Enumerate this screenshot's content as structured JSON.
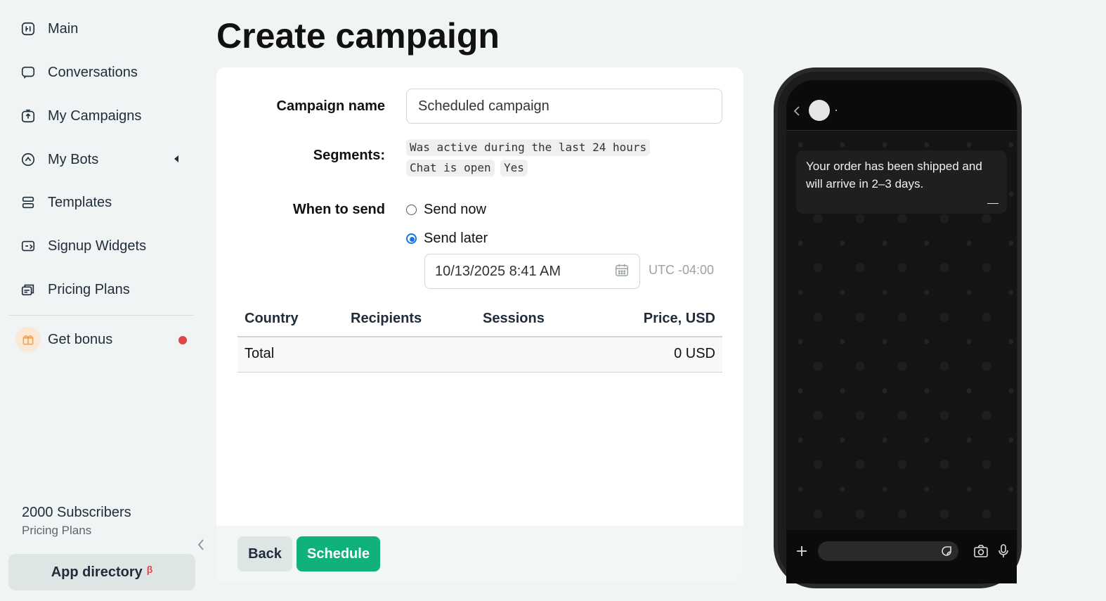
{
  "sidebar": {
    "items": [
      {
        "label": "Main",
        "icon": "home-icon"
      },
      {
        "label": "Conversations",
        "icon": "chat-icon"
      },
      {
        "label": "My Campaigns",
        "icon": "campaign-icon"
      },
      {
        "label": "My Bots",
        "icon": "bot-icon"
      },
      {
        "label": "Templates",
        "icon": "templates-icon"
      },
      {
        "label": "Signup Widgets",
        "icon": "widget-icon"
      },
      {
        "label": "Pricing Plans",
        "icon": "pricing-icon"
      }
    ],
    "bonus_label": "Get bonus",
    "subscribers": "2000 Subscribers",
    "plan_link": "Pricing Plans",
    "app_directory": "App directory",
    "beta_mark": "β"
  },
  "page": {
    "title": "Create campaign"
  },
  "form": {
    "campaign_name_label": "Campaign name",
    "campaign_name_value": "Scheduled campaign",
    "segments_label": "Segments:",
    "segments": [
      "Was active during the last 24 hours",
      "Chat is open",
      "Yes"
    ],
    "when_label": "When to send",
    "send_now": "Send now",
    "send_later": "Send later",
    "selected_option": "send_later",
    "datetime": "10/13/2025 8:41 AM",
    "timezone": "UTC -04:00"
  },
  "table": {
    "headers": [
      "Country",
      "Recipients",
      "Sessions",
      "Price, USD"
    ],
    "total_label": "Total",
    "total_value": "0 USD"
  },
  "footer": {
    "back": "Back",
    "schedule": "Schedule"
  },
  "preview": {
    "message": "Your order has been shipped and will arrive in 2–3 days."
  },
  "colors": {
    "accent": "#11b27a",
    "radio": "#1a73e8",
    "badge": "#e04646"
  }
}
